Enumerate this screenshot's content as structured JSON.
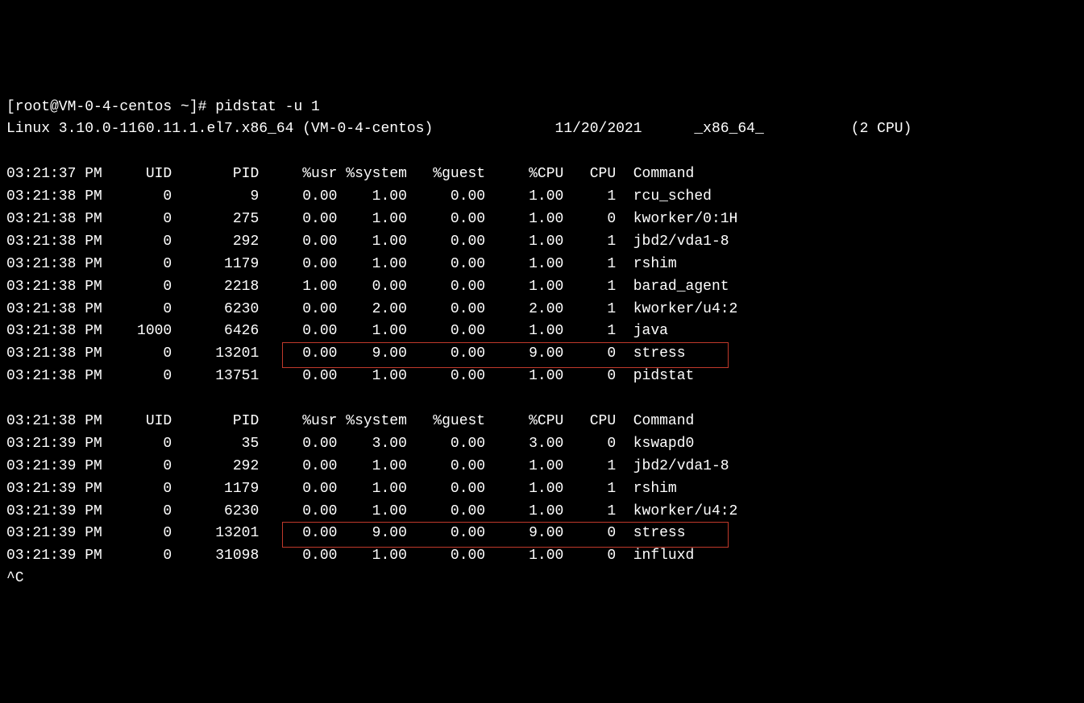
{
  "prompt": "[root@VM-0-4-centos ~]# ",
  "command": "pidstat -u 1",
  "sysline": {
    "kernel": "Linux 3.10.0-1160.11.1.el7.x86_64 (VM-0-4-centos)",
    "date": "11/20/2021",
    "arch": "_x86_64_",
    "cpu": "(2 CPU)"
  },
  "header": [
    "UID",
    "PID",
    "%usr",
    "%system",
    "%guest",
    "%CPU",
    "CPU",
    "Command"
  ],
  "blocks": [
    {
      "header_time": "03:21:37 PM",
      "rows": [
        {
          "time": "03:21:38 PM",
          "uid": "0",
          "pid": "9",
          "usr": "0.00",
          "system": "1.00",
          "guest": "0.00",
          "cpu": "1.00",
          "cpuN": "1",
          "cmd": "rcu_sched"
        },
        {
          "time": "03:21:38 PM",
          "uid": "0",
          "pid": "275",
          "usr": "0.00",
          "system": "1.00",
          "guest": "0.00",
          "cpu": "1.00",
          "cpuN": "0",
          "cmd": "kworker/0:1H"
        },
        {
          "time": "03:21:38 PM",
          "uid": "0",
          "pid": "292",
          "usr": "0.00",
          "system": "1.00",
          "guest": "0.00",
          "cpu": "1.00",
          "cpuN": "1",
          "cmd": "jbd2/vda1-8"
        },
        {
          "time": "03:21:38 PM",
          "uid": "0",
          "pid": "1179",
          "usr": "0.00",
          "system": "1.00",
          "guest": "0.00",
          "cpu": "1.00",
          "cpuN": "1",
          "cmd": "rshim"
        },
        {
          "time": "03:21:38 PM",
          "uid": "0",
          "pid": "2218",
          "usr": "1.00",
          "system": "0.00",
          "guest": "0.00",
          "cpu": "1.00",
          "cpuN": "1",
          "cmd": "barad_agent"
        },
        {
          "time": "03:21:38 PM",
          "uid": "0",
          "pid": "6230",
          "usr": "0.00",
          "system": "2.00",
          "guest": "0.00",
          "cpu": "2.00",
          "cpuN": "1",
          "cmd": "kworker/u4:2"
        },
        {
          "time": "03:21:38 PM",
          "uid": "1000",
          "pid": "6426",
          "usr": "0.00",
          "system": "1.00",
          "guest": "0.00",
          "cpu": "1.00",
          "cpuN": "1",
          "cmd": "java"
        },
        {
          "time": "03:21:38 PM",
          "uid": "0",
          "pid": "13201",
          "usr": "0.00",
          "system": "9.00",
          "guest": "0.00",
          "cpu": "9.00",
          "cpuN": "0",
          "cmd": "stress",
          "hl": true
        },
        {
          "time": "03:21:38 PM",
          "uid": "0",
          "pid": "13751",
          "usr": "0.00",
          "system": "1.00",
          "guest": "0.00",
          "cpu": "1.00",
          "cpuN": "0",
          "cmd": "pidstat"
        }
      ]
    },
    {
      "header_time": "03:21:38 PM",
      "rows": [
        {
          "time": "03:21:39 PM",
          "uid": "0",
          "pid": "35",
          "usr": "0.00",
          "system": "3.00",
          "guest": "0.00",
          "cpu": "3.00",
          "cpuN": "0",
          "cmd": "kswapd0"
        },
        {
          "time": "03:21:39 PM",
          "uid": "0",
          "pid": "292",
          "usr": "0.00",
          "system": "1.00",
          "guest": "0.00",
          "cpu": "1.00",
          "cpuN": "1",
          "cmd": "jbd2/vda1-8"
        },
        {
          "time": "03:21:39 PM",
          "uid": "0",
          "pid": "1179",
          "usr": "0.00",
          "system": "1.00",
          "guest": "0.00",
          "cpu": "1.00",
          "cpuN": "1",
          "cmd": "rshim"
        },
        {
          "time": "03:21:39 PM",
          "uid": "0",
          "pid": "6230",
          "usr": "0.00",
          "system": "1.00",
          "guest": "0.00",
          "cpu": "1.00",
          "cpuN": "1",
          "cmd": "kworker/u4:2"
        },
        {
          "time": "03:21:39 PM",
          "uid": "0",
          "pid": "13201",
          "usr": "0.00",
          "system": "9.00",
          "guest": "0.00",
          "cpu": "9.00",
          "cpuN": "0",
          "cmd": "stress",
          "hl": true
        },
        {
          "time": "03:21:39 PM",
          "uid": "0",
          "pid": "31098",
          "usr": "0.00",
          "system": "1.00",
          "guest": "0.00",
          "cpu": "1.00",
          "cpuN": "0",
          "cmd": "influxd"
        }
      ]
    }
  ],
  "interrupt": "^C"
}
